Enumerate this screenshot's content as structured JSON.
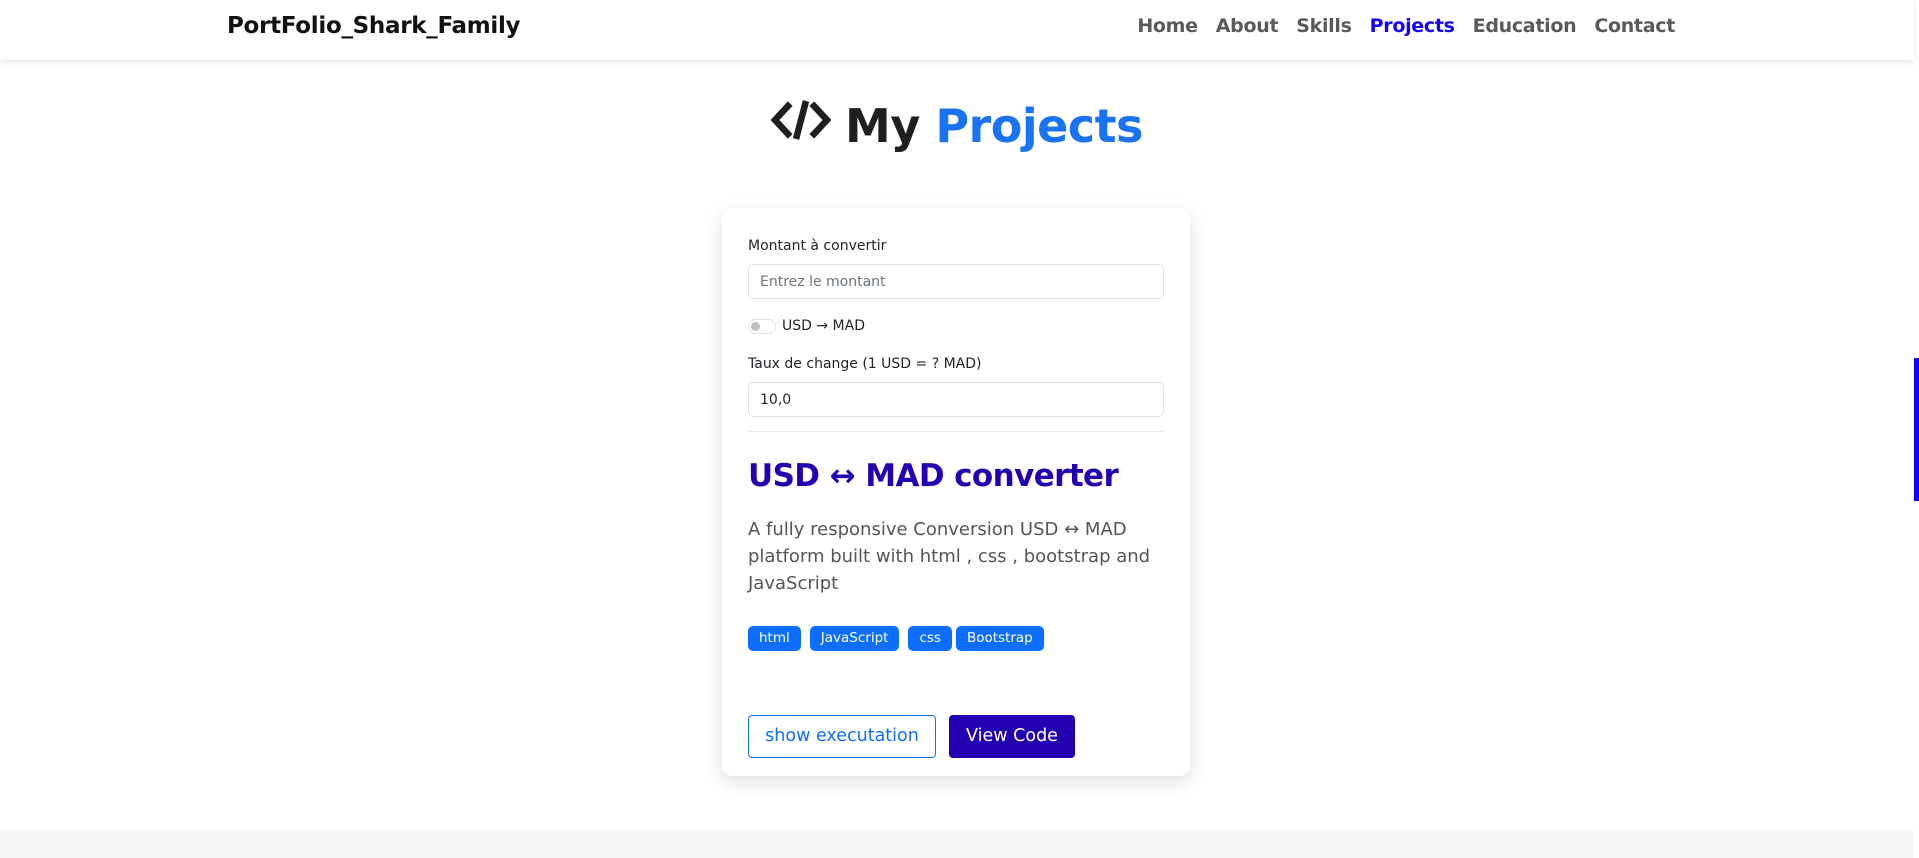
{
  "navbar": {
    "brand": "PortFolio_Shark_Family",
    "links": [
      {
        "label": "Home",
        "active": false
      },
      {
        "label": "About",
        "active": false
      },
      {
        "label": "Skills",
        "active": false
      },
      {
        "label": "Projects",
        "active": true
      },
      {
        "label": "Education",
        "active": false
      },
      {
        "label": "Contact",
        "active": false
      }
    ]
  },
  "section": {
    "heading_word_1": "My",
    "heading_word_2": "Projects",
    "icon": "code-icon"
  },
  "converter": {
    "amount_label": "Montant à convertir",
    "amount_placeholder": "Entrez le montant",
    "amount_value": "",
    "direction_label": "USD → MAD",
    "direction_toggle_on": false,
    "rate_label": "Taux de change (1 USD = ? MAD)",
    "rate_value": "10,0"
  },
  "project": {
    "title": "USD ↔ MAD converter",
    "description": "A fully responsive Conversion USD ↔ MAD platform built with html , css , bootstrap and JavaScript",
    "tags": [
      "html",
      "JavaScript",
      "css",
      "Bootstrap"
    ],
    "show_button": "show executation",
    "code_button": "View Code"
  },
  "colors": {
    "accent_blue": "#1a73f0",
    "nav_active": "#1400ff",
    "title_purple": "#2300b0",
    "tag_blue": "#0d6efd"
  }
}
